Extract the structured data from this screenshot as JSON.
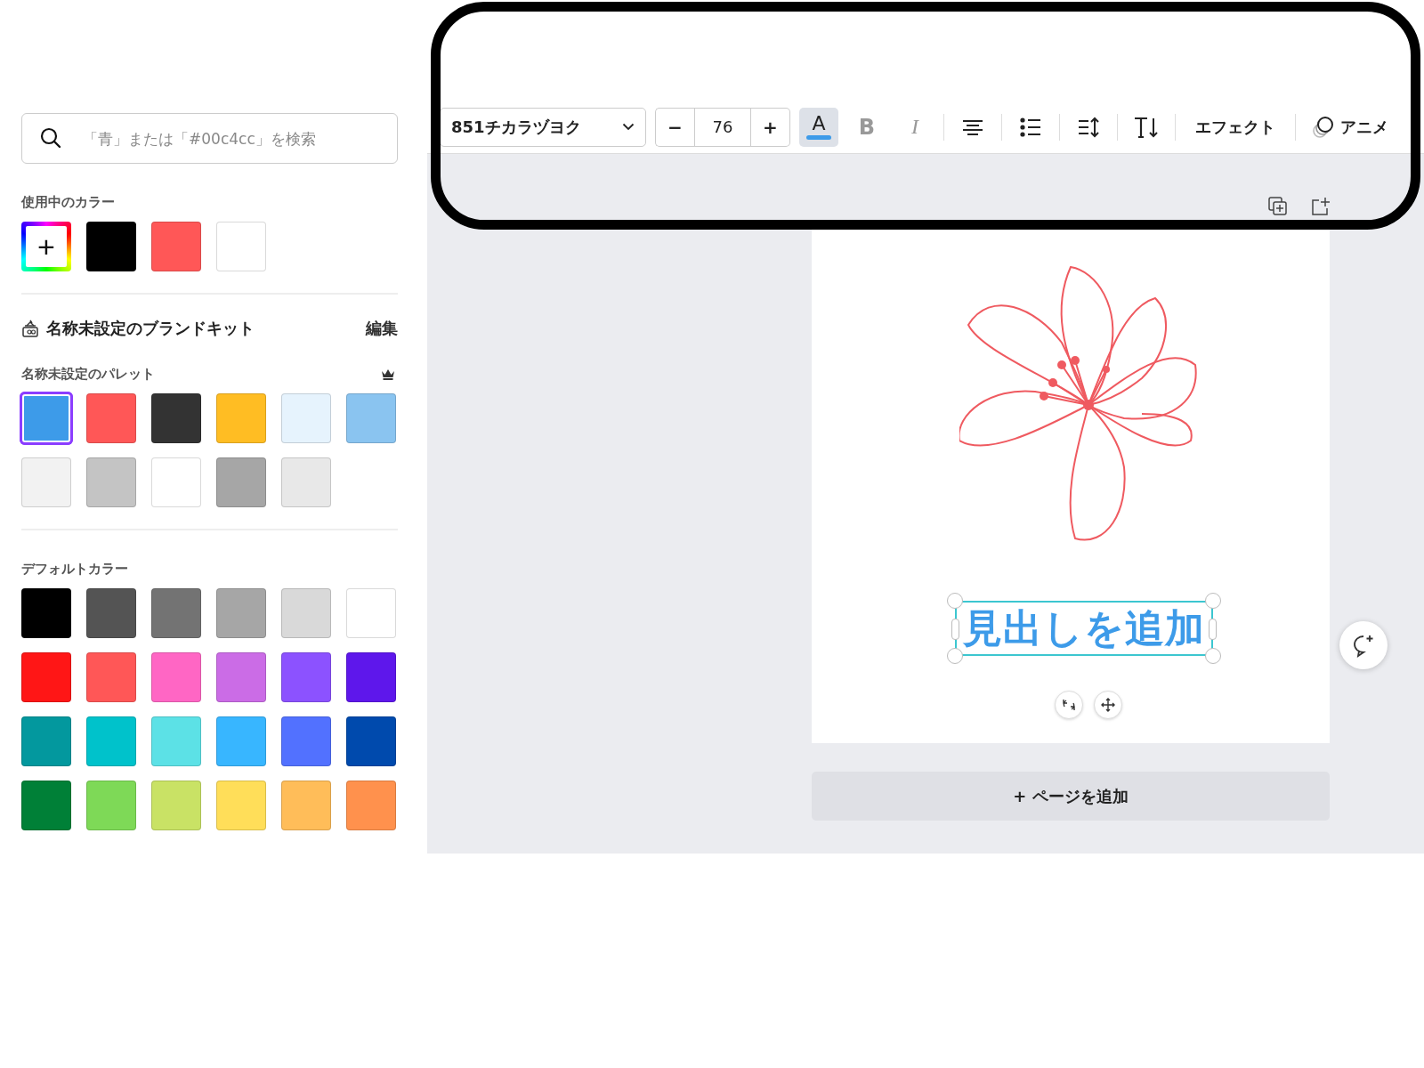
{
  "search": {
    "placeholder": "「青」または「#00c4cc」を検索"
  },
  "used_colors": {
    "title": "使用中のカラー",
    "items": [
      {
        "kind": "add",
        "label": "+"
      },
      {
        "kind": "swatch",
        "color": "#000000"
      },
      {
        "kind": "swatch",
        "color": "#ff5757"
      },
      {
        "kind": "swatch",
        "color": "#ffffff"
      }
    ]
  },
  "brand_kit": {
    "title": "名称未設定のブランドキット",
    "edit": "編集",
    "palette_title": "名称未設定のパレット",
    "colors": [
      {
        "color": "#3d9be9",
        "selected": true
      },
      {
        "color": "#ff5757",
        "selected": false
      },
      {
        "color": "#333333",
        "selected": false
      },
      {
        "color": "#ffbd23",
        "selected": false
      },
      {
        "color": "#e6f3fd",
        "selected": false
      },
      {
        "color": "#8ac4f0",
        "selected": false
      },
      {
        "color": "#f2f2f2",
        "selected": false
      },
      {
        "color": "#c4c4c4",
        "selected": false
      },
      {
        "color": "#ffffff",
        "selected": false
      },
      {
        "color": "#a6a6a6",
        "selected": false
      },
      {
        "color": "#e8e8e8",
        "selected": false
      }
    ]
  },
  "default_colors": {
    "title": "デフォルトカラー",
    "colors": [
      {
        "color": "#000000"
      },
      {
        "color": "#545454"
      },
      {
        "color": "#737373"
      },
      {
        "color": "#a6a6a6"
      },
      {
        "color": "#d9d9d9"
      },
      {
        "color": "#ffffff"
      },
      {
        "color": "#ff1616"
      },
      {
        "color": "#ff5757"
      },
      {
        "color": "#ff66c4"
      },
      {
        "color": "#cb6ce6"
      },
      {
        "color": "#8c52ff"
      },
      {
        "color": "#5e17eb"
      },
      {
        "color": "#03989e"
      },
      {
        "color": "#00c2cb"
      },
      {
        "color": "#5ce1e6"
      },
      {
        "color": "#38b6ff"
      },
      {
        "color": "#5271ff"
      },
      {
        "color": "#004aad"
      },
      {
        "color": "#008037"
      },
      {
        "color": "#7ed957"
      },
      {
        "color": "#c9e265"
      },
      {
        "color": "#ffde59"
      },
      {
        "color": "#ffbd59"
      },
      {
        "color": "#ff914d"
      }
    ]
  },
  "toolbar": {
    "font": "851チカラヅヨク",
    "decrease": "−",
    "size": "76",
    "increase": "+",
    "tools": [
      {
        "kind": "text-color",
        "label": "A",
        "active": true
      },
      {
        "kind": "bold",
        "label": "B",
        "active": false
      },
      {
        "kind": "italic",
        "label": "I",
        "active": false
      },
      {
        "kind": "align"
      },
      {
        "kind": "list"
      },
      {
        "kind": "spacing"
      },
      {
        "kind": "vertical"
      },
      {
        "kind": "effects",
        "label": "エフェクト"
      },
      {
        "kind": "animate",
        "label": "アニメ"
      }
    ]
  },
  "canvas": {
    "heading": "見出しを追加",
    "add_page": "+ ページを追加"
  }
}
